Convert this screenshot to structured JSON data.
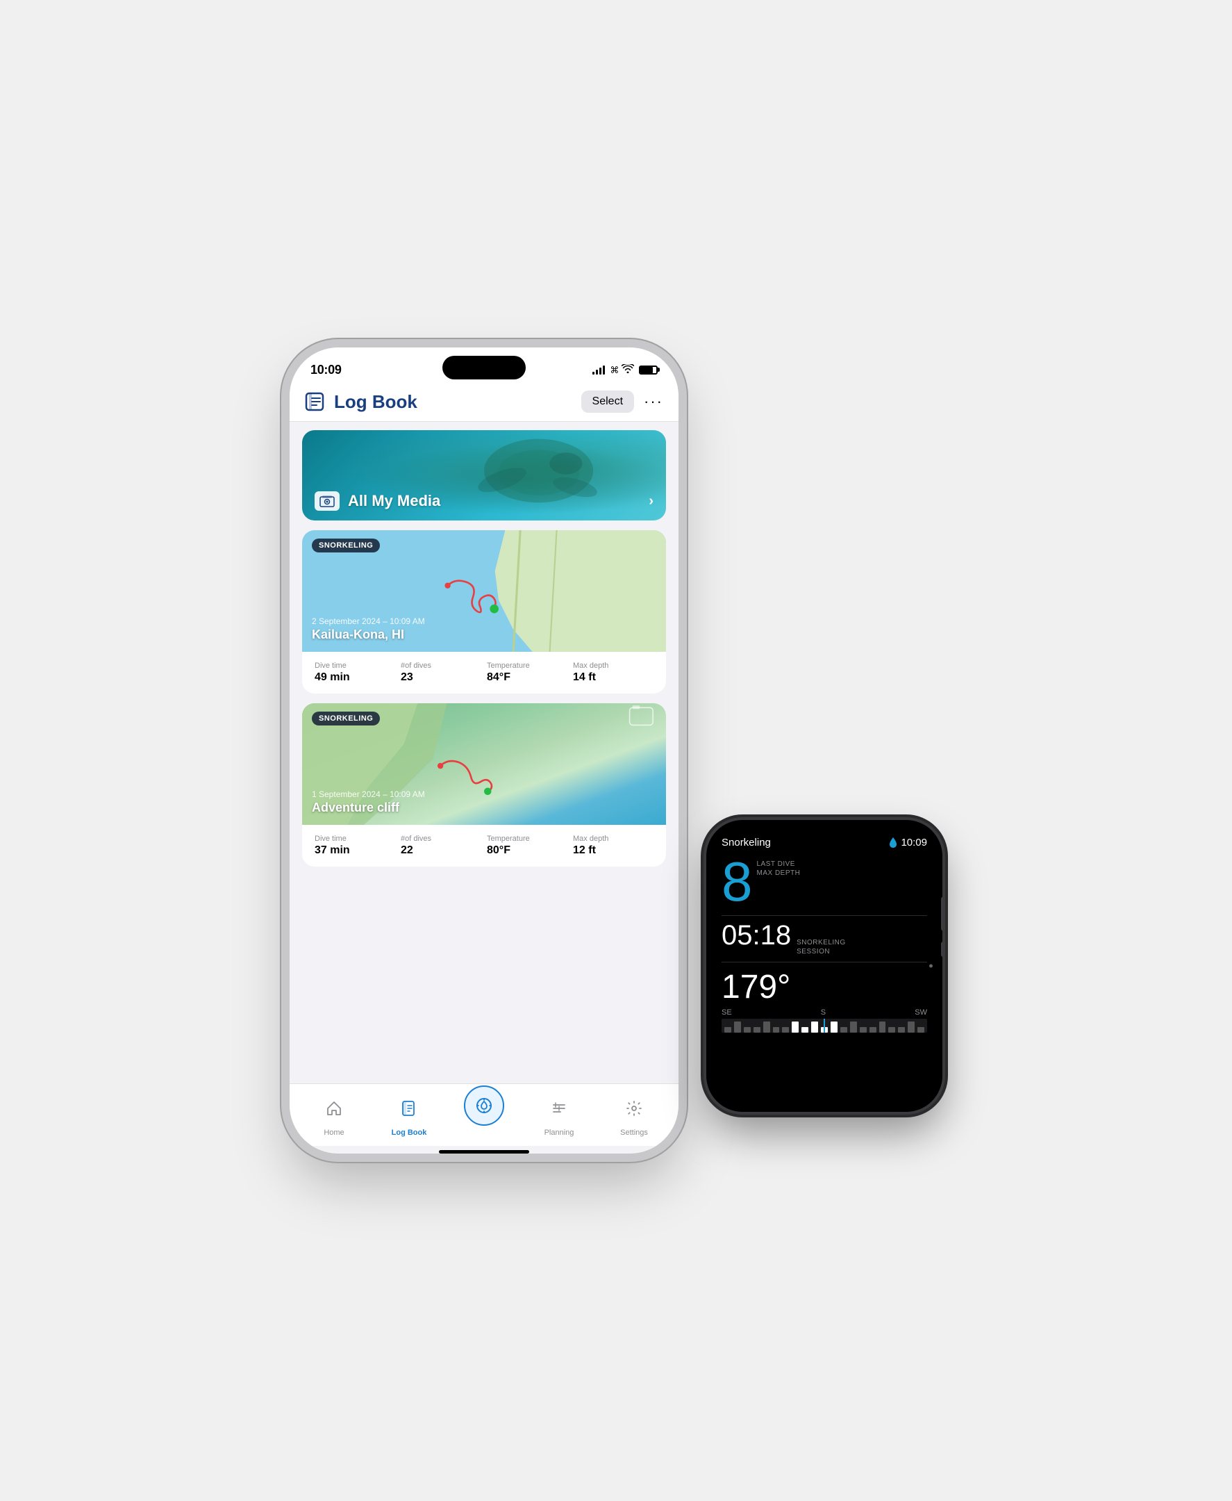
{
  "scene": {
    "bg_color": "#efefef"
  },
  "iphone": {
    "status_bar": {
      "time": "10:09",
      "signal_bars": [
        3,
        6,
        9,
        12,
        12
      ],
      "wifi": "wifi",
      "battery": "battery"
    },
    "nav": {
      "title": "Log Book",
      "select_btn": "Select",
      "more_btn": "···"
    },
    "media_card": {
      "title": "All My Media",
      "chevron": "›"
    },
    "log_entries": [
      {
        "badge": "SNORKELING",
        "date": "2 September 2024 – 10:09 AM",
        "location": "Kailua-Kona, HI",
        "stats": [
          {
            "label": "Dive time",
            "value": "49 min"
          },
          {
            "label": "#of dives",
            "value": "23"
          },
          {
            "label": "Temperature",
            "value": "84°F"
          },
          {
            "label": "Max depth",
            "value": "14 ft"
          }
        ]
      },
      {
        "badge": "SNORKELING",
        "date": "1 September 2024 – 10:09 AM",
        "location": "Adventure cliff",
        "stats": [
          {
            "label": "Dive time",
            "value": "37 min"
          },
          {
            "label": "#of dives",
            "value": "22"
          },
          {
            "label": "Temperature",
            "value": "80°F"
          },
          {
            "label": "Max depth",
            "value": "12 ft"
          }
        ]
      }
    ],
    "tab_bar": {
      "items": [
        {
          "icon": "⌂",
          "label": "Home",
          "active": false
        },
        {
          "icon": "📋",
          "label": "Log Book",
          "active": true
        },
        {
          "icon": "⚓",
          "label": "",
          "active": false,
          "center": true
        },
        {
          "icon": "≡",
          "label": "Planning",
          "active": false
        },
        {
          "icon": "⚙",
          "label": "Settings",
          "active": false
        }
      ]
    }
  },
  "watch": {
    "activity": "Snorkeling",
    "drop_icon": "💧",
    "time": "10:09",
    "big_number": "8",
    "big_number_label_line1": "LAST DIVE",
    "big_number_label_line2": "MAX DEPTH",
    "session_time": "05:18",
    "session_label_line1": "SNORKELING",
    "session_label_line2": "SESSION",
    "heading": "179°",
    "compass_labels": [
      "SE",
      "S",
      "SW"
    ],
    "dots_right": "···"
  }
}
